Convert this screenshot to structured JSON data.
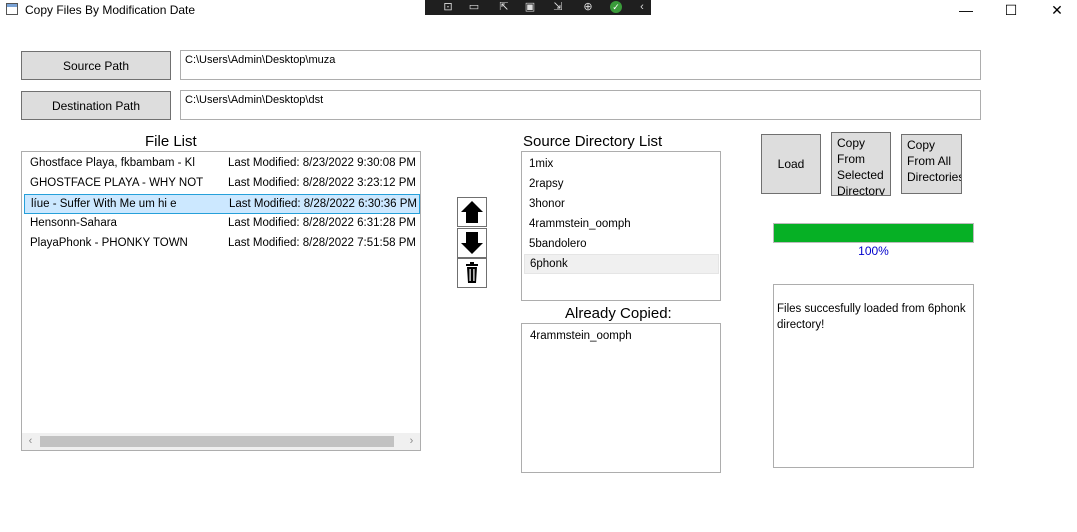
{
  "window": {
    "title": "Copy Files By Modification Date",
    "controls": {
      "minimize": "—",
      "maximize": "☐",
      "close": "✕"
    }
  },
  "source": {
    "button_label": "Source Path",
    "path": "C:\\Users\\Admin\\Desktop\\muza"
  },
  "destination": {
    "button_label": "Destination Path",
    "path": "C:\\Users\\Admin\\Desktop\\dst"
  },
  "file_list": {
    "header": "File List",
    "items": [
      {
        "name": "Ghostface Playa, fkbambam - Kl",
        "modified": "Last Modified: 8/23/2022 9:30:08 PM"
      },
      {
        "name": "GHOSTFACE PLAYA - WHY NOT",
        "modified": "Last Modified: 8/28/2022 3:23:12 PM"
      },
      {
        "name": "líue - Suffer With Me  um hi e",
        "modified": "Last Modified: 8/28/2022 6:30:36 PM",
        "selected": true
      },
      {
        "name": "Hensonn-Sahara",
        "modified": "Last Modified: 8/28/2022 6:31:28 PM"
      },
      {
        "name": "PlayaPhonk - PHONKY TOWN",
        "modified": "Last Modified: 8/28/2022 7:51:58 PM"
      }
    ]
  },
  "order_buttons": {
    "up_icon": "arrow-up",
    "down_icon": "arrow-down",
    "delete_icon": "trash"
  },
  "source_dirs": {
    "header": "Source Directory List",
    "items": [
      "1mix",
      "2rapsy",
      "3honor",
      "4rammstein_oomph",
      "5bandolero",
      "6phonk"
    ]
  },
  "already_copied": {
    "header": "Already Copied:",
    "items": [
      "4rammstein_oomph"
    ]
  },
  "actions": {
    "load": "Load",
    "copy_selected": "Copy\nFrom\nSelected\nDirectory",
    "copy_all": "Copy\nFrom All\nDirectories"
  },
  "progress": {
    "value": 1.0,
    "label": "100%",
    "color": "#06b025"
  },
  "message": "Files succesfully loaded from 6phonk directory!"
}
